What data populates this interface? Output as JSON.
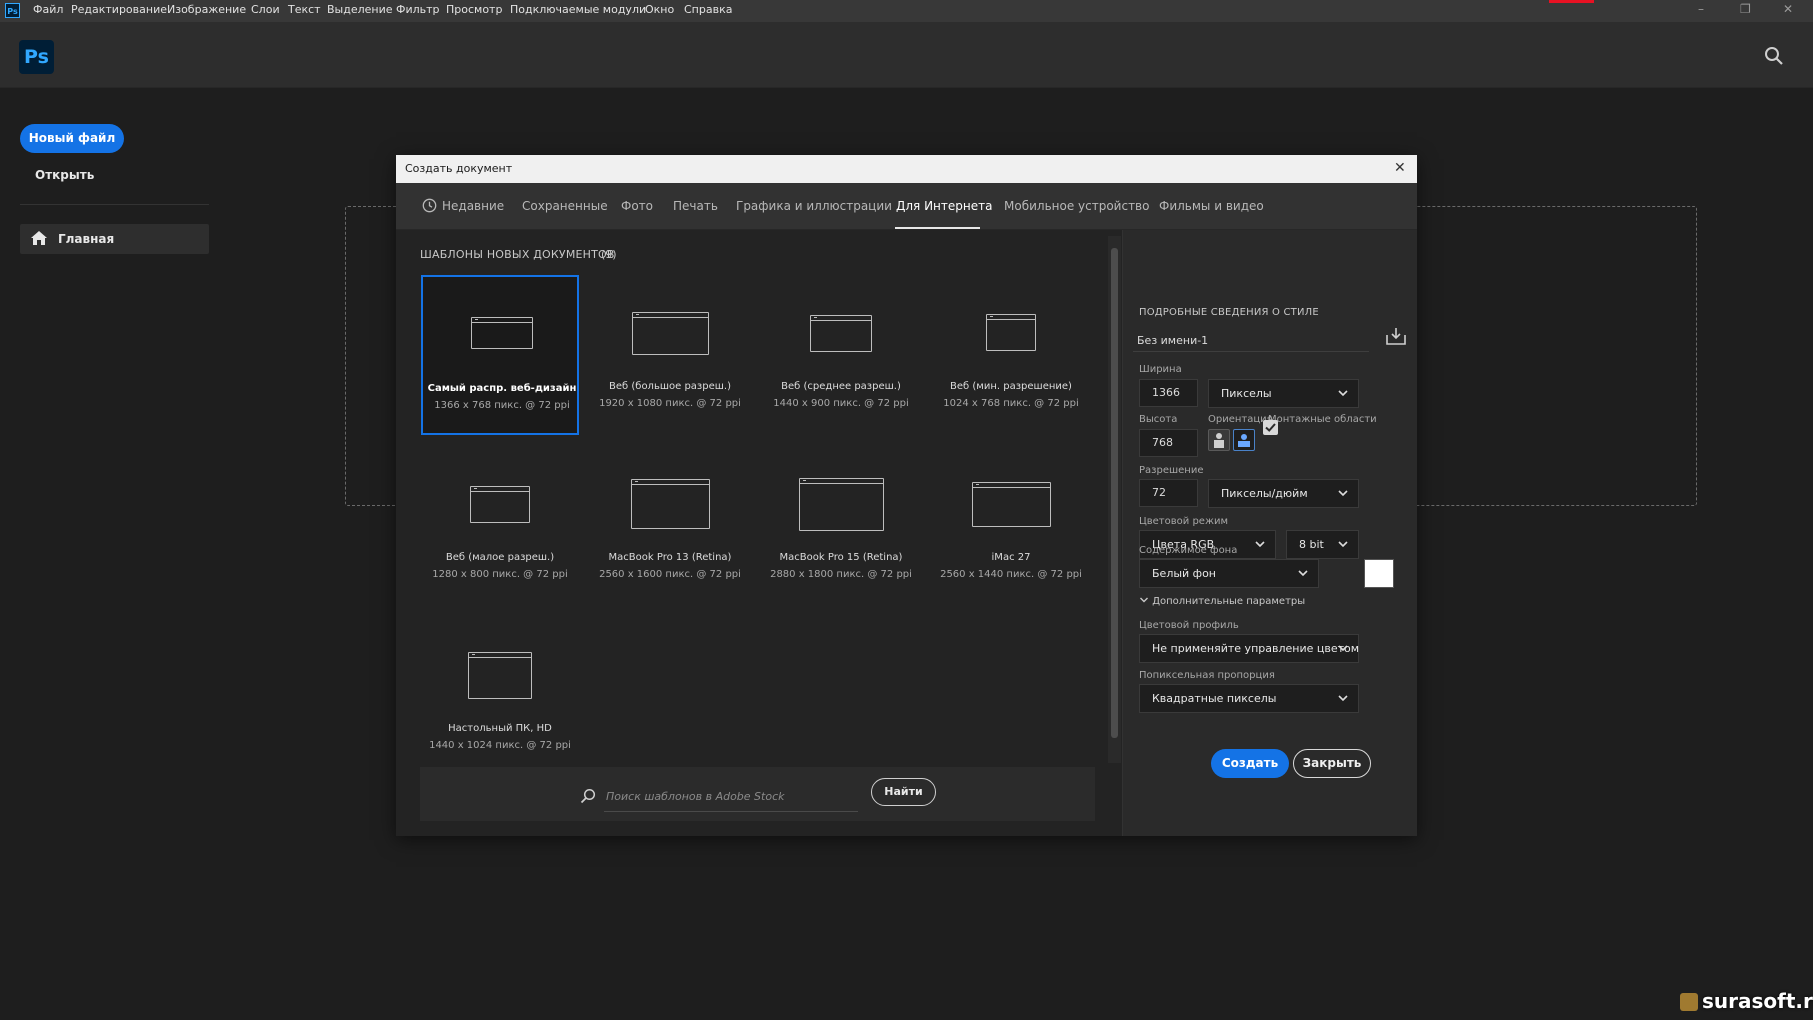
{
  "menubar": {
    "app_icon": "Ps",
    "items": [
      "Файл",
      "Редактирование",
      "Изображение",
      "Слои",
      "Текст",
      "Выделение",
      "Фильтр",
      "Просмотр",
      "Подключаемые модули",
      "Окно",
      "Справка"
    ]
  },
  "header": {
    "logo": "Ps",
    "search_icon": "search-icon"
  },
  "home": {
    "new_file": "Новый файл",
    "open": "Открыть",
    "nav_home": "Главная"
  },
  "dialog": {
    "title": "Создать документ",
    "tabs": [
      "Недавние",
      "Сохраненные",
      "Фото",
      "Печать",
      "Графика и иллюстрации",
      "Для Интернета",
      "Мобильное устройство",
      "Фильмы и видео"
    ],
    "active_tab": "Для Интернета",
    "templates_heading": "ШАБЛОНЫ НОВЫХ ДОКУМЕНТОВ",
    "templates_count": "(9)",
    "templates": [
      {
        "title": "Самый распр. веб-дизайн",
        "size": "1366 x 768 пикс. @ 72 ppi",
        "selected": true
      },
      {
        "title": "Веб (большое разреш.)",
        "size": "1920 x 1080 пикс. @ 72 ppi",
        "selected": false
      },
      {
        "title": "Веб (среднее разреш.)",
        "size": "1440 x 900 пикс. @ 72 ppi",
        "selected": false
      },
      {
        "title": "Веб (мин. разрешение)",
        "size": "1024 x 768 пикс. @ 72 ppi",
        "selected": false
      },
      {
        "title": "Веб (малое разреш.)",
        "size": "1280 x 800 пикс. @ 72 ppi",
        "selected": false
      },
      {
        "title": "MacBook Pro 13 (Retina)",
        "size": "2560 x 1600 пикс. @ 72 ppi",
        "selected": false
      },
      {
        "title": "MacBook Pro 15 (Retina)",
        "size": "2880 x 1800 пикс. @ 72 ppi",
        "selected": false
      },
      {
        "title": "iMac 27",
        "size": "2560 x 1440 пикс. @ 72 ppi",
        "selected": false
      },
      {
        "title": "Настольный ПК, HD",
        "size": "1440 x 1024 пикс. @ 72 ppi",
        "selected": false
      }
    ],
    "stock_placeholder": "Поиск шаблонов в Adobe Stock",
    "find_button": "Найти",
    "details": {
      "heading": "ПОДРОБНЫЕ СВЕДЕНИЯ О СТИЛЕ",
      "doc_name": "Без имени-1",
      "width_label": "Ширина",
      "width_value": "1366",
      "width_unit": "Пикселы",
      "height_label": "Высота",
      "height_value": "768",
      "orientation_label": "Ориентация",
      "artboards_label": "Монтажные области",
      "artboards_checked": true,
      "resolution_label": "Разрешение",
      "resolution_value": "72",
      "resolution_unit": "Пикселы/дюйм",
      "color_mode_label": "Цветовой режим",
      "color_mode": "Цвета RGB",
      "bit_depth": "8 bit",
      "bg_label": "Содержимое фона",
      "bg_value": "Белый фон",
      "bg_color": "#ffffff",
      "advanced_toggle": "Дополнительные параметры",
      "profile_label": "Цветовой профиль",
      "profile_value": "Не применяйте управление цветом",
      "pixel_aspect_label": "Попиксельная пропорция",
      "pixel_aspect_value": "Квадратные пикселы"
    },
    "create_button": "Создать",
    "close_button": "Закрыть"
  },
  "watermark": "surasoft.ru",
  "colors": {
    "accent": "#1473e6",
    "bg": "#1e1e1e",
    "panel": "#323232"
  }
}
